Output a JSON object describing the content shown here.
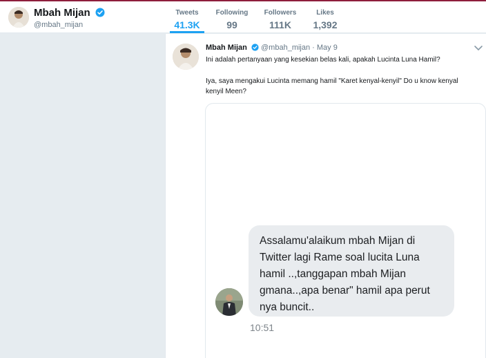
{
  "profile": {
    "name": "Mbah Mijan",
    "handle": "@mbah_mijan"
  },
  "stats": [
    {
      "label": "Tweets",
      "value": "41.3K",
      "active": true
    },
    {
      "label": "Following",
      "value": "99"
    },
    {
      "label": "Followers",
      "value": "111K"
    },
    {
      "label": "Likes",
      "value": "1,392"
    }
  ],
  "tweet": {
    "name": "Mbah Mijan",
    "handle": "@mbah_mijan",
    "date": "May 9",
    "separator": " · ",
    "text1": "Ini adalah pertanyaan yang kesekian belas kali, apakah Lucinta Luna Hamil?",
    "text2": "Iya, saya mengakui Lucinta memang hamil \"Karet kenyal-kenyil\" Do u know kenyal kenyil Meen?"
  },
  "media": {
    "message": "Assalamu'alaikum mbah Mijan di Twitter lagi Rame soal lucita Luna hamil ..,tanggapan mbah Mijan gmana..,apa benar\" hamil apa perut nya buncit..",
    "time": "10:51"
  },
  "colors": {
    "accent": "#1da1f2",
    "verified": "#1da1f2",
    "top_line": "#8e1e3c",
    "background": "#e6ecf0"
  },
  "icons": [
    "verified-badge-icon",
    "chevron-down-icon"
  ]
}
